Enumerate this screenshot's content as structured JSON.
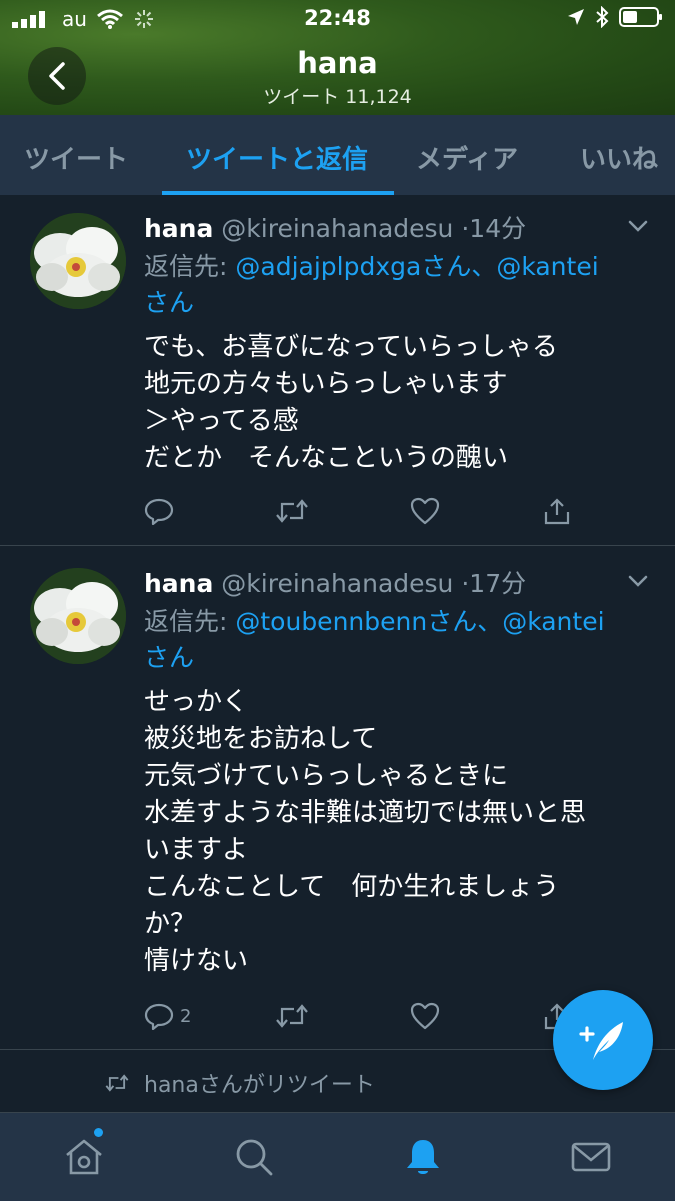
{
  "status_bar": {
    "carrier": "au",
    "time": "22:48"
  },
  "header": {
    "profile_name": "hana",
    "tweet_count": "ツイート 11,124"
  },
  "tabs": [
    {
      "label": "ツイート",
      "active": false
    },
    {
      "label": "ツイートと返信",
      "active": true
    },
    {
      "label": "メディア",
      "active": false
    },
    {
      "label": "いいね",
      "active": false
    }
  ],
  "tweets": [
    {
      "name": "hana",
      "handle": "@kireinahanadesu",
      "time": "·14分",
      "reply_prefix": "返信先: ",
      "reply_users": "@adjajplpdxgaさん、@kantei",
      "reply_suffix": "さん",
      "body": "でも、お喜びになっていらっしゃる\n地元の方々もいらっしゃいます\n＞やってる感\nだとか　そんなこというの醜い",
      "reply_count": ""
    },
    {
      "name": "hana",
      "handle": "@kireinahanadesu",
      "time": "·17分",
      "reply_prefix": "返信先: ",
      "reply_users": "@toubennbennさん、@kantei",
      "reply_suffix": "さん",
      "body": "せっかく\n被災地をお訪ねして\n元気づけていらっしゃるときに\n水差すような非難は適切では無いと思\nいますよ\nこんなことして　何か生れましょう\nか？\n情けない",
      "reply_count": "2"
    }
  ],
  "retweet_notice": "hanaさんがリツイート",
  "colors": {
    "background": "#15202b",
    "bar": "#243447",
    "accent": "#1da1f2",
    "muted": "#8899a6"
  },
  "icons": {
    "back": "chevron-left-icon",
    "compose": "compose-tweet-icon",
    "nav": [
      "home-icon",
      "search-icon",
      "notifications-icon",
      "messages-icon"
    ]
  }
}
